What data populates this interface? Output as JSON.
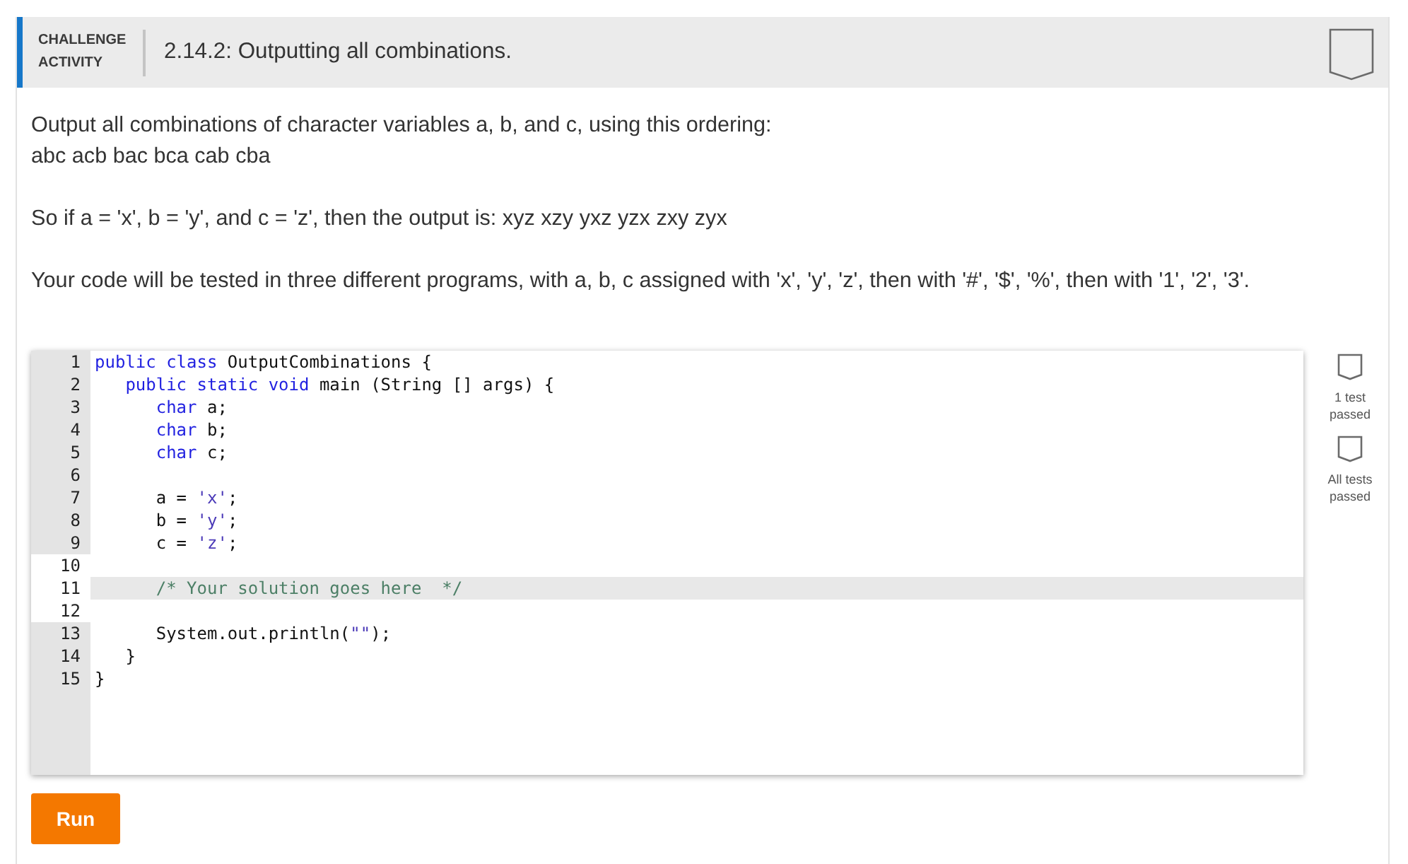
{
  "header": {
    "label": "CHALLENGE ACTIVITY",
    "title": "2.14.2: Outputting all combinations.",
    "completed": false
  },
  "paragraphs": [
    [
      "Output all combinations of character variables a, b, and c, using this ordering:",
      "abc acb bac bca cab cba"
    ],
    [
      "So if a = 'x', b = 'y', and c = 'z', then the output is: xyz xzy yxz yzx zxy zyx"
    ],
    [
      "Your code will be tested in three different programs, with a, b, c assigned with 'x', 'y', 'z', then with '#', '$', '%', then with '1', '2', '3'."
    ]
  ],
  "code": {
    "lines": [
      {
        "number": "1",
        "read_only": true,
        "active": false,
        "tokens": [
          {
            "kind": "keyword",
            "text": "public class"
          },
          {
            "kind": "plain",
            "text": " OutputCombinations {"
          }
        ]
      },
      {
        "number": "2",
        "read_only": true,
        "active": false,
        "tokens": [
          {
            "kind": "keyword",
            "text": "   public static void"
          },
          {
            "kind": "plain",
            "text": " main (String [] args) {"
          }
        ]
      },
      {
        "number": "3",
        "read_only": true,
        "active": false,
        "tokens": [
          {
            "kind": "keyword",
            "text": "      char"
          },
          {
            "kind": "plain",
            "text": " a;"
          }
        ]
      },
      {
        "number": "4",
        "read_only": true,
        "active": false,
        "tokens": [
          {
            "kind": "keyword",
            "text": "      char"
          },
          {
            "kind": "plain",
            "text": " b;"
          }
        ]
      },
      {
        "number": "5",
        "read_only": true,
        "active": false,
        "tokens": [
          {
            "kind": "keyword",
            "text": "      char"
          },
          {
            "kind": "plain",
            "text": " c;"
          }
        ]
      },
      {
        "number": "6",
        "read_only": true,
        "active": false
      },
      {
        "number": "7",
        "read_only": true,
        "active": false,
        "tokens": [
          {
            "kind": "plain",
            "text": "      a = "
          },
          {
            "kind": "string",
            "text": "'x'"
          },
          {
            "kind": "plain",
            "text": ";"
          }
        ]
      },
      {
        "number": "8",
        "read_only": true,
        "active": false,
        "tokens": [
          {
            "kind": "plain",
            "text": "      b = "
          },
          {
            "kind": "string",
            "text": "'y'"
          },
          {
            "kind": "plain",
            "text": ";"
          }
        ]
      },
      {
        "number": "9",
        "read_only": true,
        "active": false,
        "tokens": [
          {
            "kind": "plain",
            "text": "      c = "
          },
          {
            "kind": "string",
            "text": "'z'"
          },
          {
            "kind": "plain",
            "text": ";"
          }
        ]
      },
      {
        "number": "10",
        "read_only": false,
        "active": false
      },
      {
        "number": "11",
        "read_only": false,
        "active": true,
        "tokens": [
          {
            "kind": "comment",
            "text": "      /* Your solution goes here  */"
          }
        ]
      },
      {
        "number": "12",
        "read_only": false,
        "active": false
      },
      {
        "number": "13",
        "read_only": true,
        "active": false,
        "tokens": [
          {
            "kind": "plain",
            "text": "      System.out.println("
          },
          {
            "kind": "string",
            "text": "\"\""
          },
          {
            "kind": "plain",
            "text": ");"
          }
        ]
      },
      {
        "number": "14",
        "read_only": true,
        "active": false,
        "tokens": [
          {
            "kind": "plain",
            "text": "   }"
          }
        ]
      },
      {
        "number": "15",
        "read_only": true,
        "active": false,
        "tokens": [
          {
            "kind": "plain",
            "text": "}"
          }
        ]
      }
    ]
  },
  "tests": [
    {
      "label": "1 test passed",
      "passed": false
    },
    {
      "label": "All tests passed",
      "passed": false
    }
  ],
  "run_button": {
    "label": "Run"
  }
}
